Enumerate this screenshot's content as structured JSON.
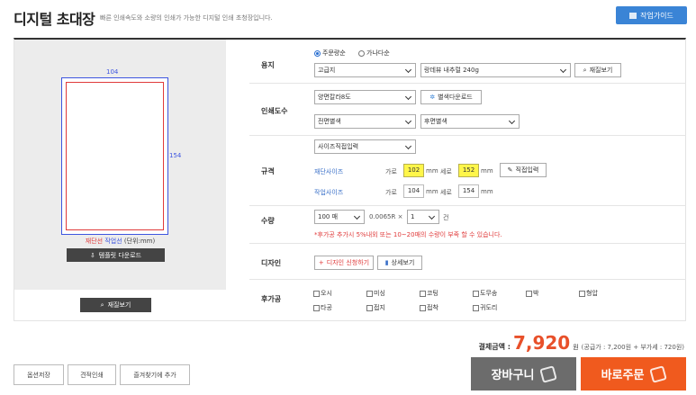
{
  "header": {
    "title": "디지털 초대장",
    "subtitle": "빠른 인쇄속도와 소량의 인쇄가 가능한 디지털 인쇄 초청장입니다.",
    "guide_label": "작업가이드"
  },
  "preview": {
    "width_label": "104",
    "height_label": "154",
    "legend_cut": "재단선",
    "legend_work": "작업선",
    "legend_unit": "(단위:mm)",
    "template_download": "템플릿 다운로드",
    "paper_view": "재질보기"
  },
  "paper": {
    "label": "용지",
    "radio_single": "주문량순",
    "radio_multi": "가나다순",
    "type_value": "고급지",
    "name_value": "랑데뷰 내추럴 240g",
    "view_label": "재질보기"
  },
  "color": {
    "label": "인쇄도수",
    "sides_value": "양면칼라8도",
    "download_label": "별색다운로드",
    "front_value": "전면별색",
    "back_value": "후면별색"
  },
  "size": {
    "label": "규격",
    "mode_value": "사이즈직접입력",
    "cut_label": "재단사이즈",
    "work_label": "작업사이즈",
    "w_label": "가로",
    "h_label": "세로",
    "unit": "mm",
    "cut_w": "102",
    "cut_h": "152",
    "work_w": "104",
    "work_h": "154",
    "direct_input": "직접입력"
  },
  "qty": {
    "label": "수량",
    "count_value": "100 매",
    "rate_text": "0.0065R ×",
    "sets_value": "1",
    "unit": "건",
    "notice": "*후가공 추가시 5%내외 또는 10~20매의 수량이 부족 할 수 있습니다."
  },
  "design": {
    "label": "디자인",
    "request": "디자인 신청하기",
    "detail": "상세보기"
  },
  "finish": {
    "label": "후가공",
    "options": [
      "오시",
      "미싱",
      "코팅",
      "도무송",
      "박",
      "형압",
      "타공",
      "접지",
      "접착",
      "귀도리"
    ]
  },
  "total": {
    "label": "결제금액 :",
    "amount": "7,920",
    "won": "원",
    "breakdown": "(공급가 : 7,200원 + 부가세 : 720원)"
  },
  "actions": {
    "save_option": "옵션저장",
    "quote_print": "견적인쇄",
    "favorite": "즐겨찾기에 추가",
    "cart": "장바구니",
    "order": "바로주문"
  },
  "colors": {
    "accent": "#3a84d6",
    "order": "#f05a1e",
    "price": "#e8502a",
    "cart": "#6c6c6c"
  }
}
